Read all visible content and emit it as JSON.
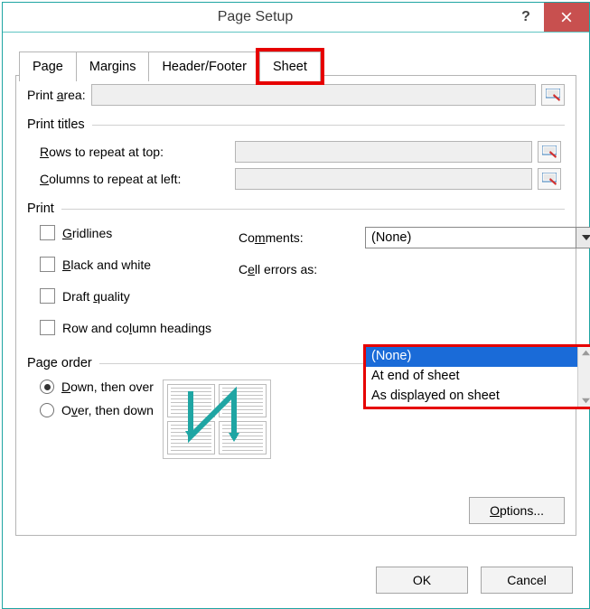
{
  "window": {
    "title": "Page Setup"
  },
  "tabs": {
    "page": "Page",
    "margins": "Margins",
    "header_footer": "Header/Footer",
    "sheet": "Sheet"
  },
  "print_area": {
    "label": "Print area:"
  },
  "print_titles": {
    "group": "Print titles",
    "rows_label": "Rows to repeat at top:",
    "cols_label": "Columns to repeat at left:"
  },
  "print": {
    "group": "Print",
    "gridlines": "Gridlines",
    "black_white": "Black and white",
    "draft": "Draft quality",
    "row_col_headings": "Row and column headings",
    "comments_label": "Comments:",
    "comments_value": "(None)",
    "cell_errors_label": "Cell errors as:",
    "options": {
      "none": "(None)",
      "end": "At end of sheet",
      "displayed": "As displayed on sheet"
    }
  },
  "page_order": {
    "group": "Page order",
    "down_over": "Down, then over",
    "over_down": "Over, then down"
  },
  "buttons": {
    "options": "Options...",
    "ok": "OK",
    "cancel": "Cancel"
  }
}
